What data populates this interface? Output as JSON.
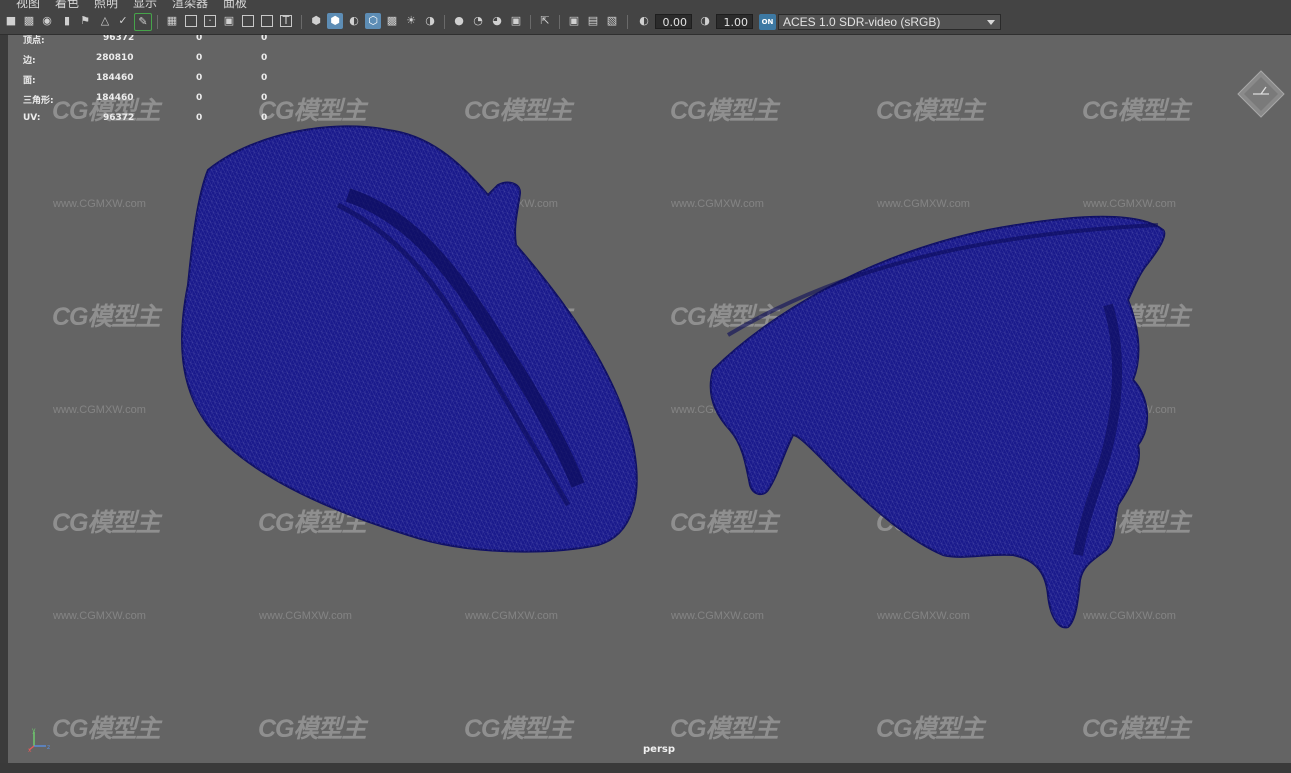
{
  "menu": [
    "视图",
    "着色",
    "照明",
    "显示",
    "渲染器",
    "面板"
  ],
  "toolbar": {
    "exposure_value": "0.00",
    "gamma_value": "1.00",
    "color_space_badge": "ON",
    "color_space": "ACES 1.0 SDR-video (sRGB)"
  },
  "hud": {
    "rows": [
      {
        "label": "顶点:",
        "count": "96372",
        "selected": "0",
        "uv_selected": "0"
      },
      {
        "label": "边:",
        "count": "280810",
        "selected": "0",
        "uv_selected": "0"
      },
      {
        "label": "面:",
        "count": "184460",
        "selected": "0",
        "uv_selected": "0"
      },
      {
        "label": "三角形:",
        "count": "184460",
        "selected": "0",
        "uv_selected": "0"
      },
      {
        "label": "UV:",
        "count": "96372",
        "selected": "0",
        "uv_selected": "0"
      }
    ]
  },
  "watermark": {
    "logo": "CG模型主",
    "url": "www.CGMXW.com"
  },
  "viewport": {
    "camera": "persp",
    "wire_color": "#1a1a8c",
    "background_color": "#646464"
  },
  "axis": {
    "x": "x",
    "y": "y",
    "z": "z"
  }
}
